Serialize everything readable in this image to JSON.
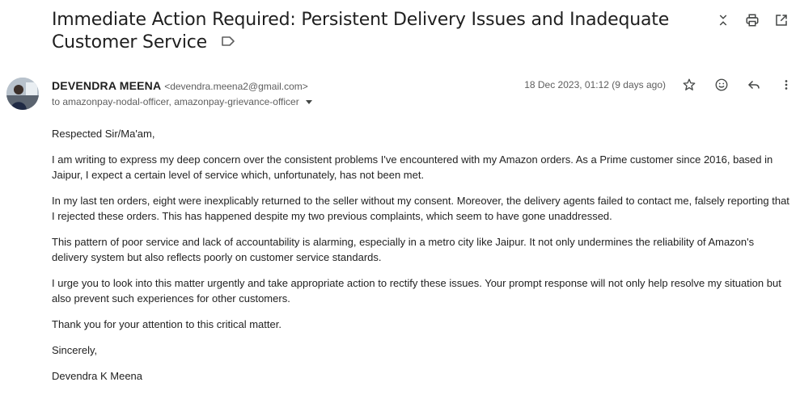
{
  "email": {
    "subject": "Immediate Action Required: Persistent Delivery Issues and Inadequate Customer Service",
    "sender_name": "DEVENDRA MEENA",
    "sender_email": "<devendra.meena2@gmail.com>",
    "recipients": "to amazonpay-nodal-officer, amazonpay-grievance-officer",
    "date": "18 Dec 2023, 01:12 (9 days ago)",
    "body": [
      "Respected Sir/Ma'am,",
      "I am writing to express my deep concern over the consistent problems I've encountered with my Amazon orders. As a Prime customer since 2016, based in Jaipur, I expect a certain level of service which, unfortunately, has not been met.",
      "In my last ten orders, eight were inexplicably returned to the seller without my consent. Moreover, the delivery agents failed to contact me, falsely reporting that I rejected these orders. This has happened despite my two previous complaints, which seem to have gone unaddressed.",
      "This pattern of poor service and lack of accountability is alarming, especially in a metro city like Jaipur. It not only undermines the reliability of Amazon's delivery system but also reflects poorly on customer service standards.",
      "I urge you to look into this matter urgently and take appropriate action to rectify these issues. Your prompt response will not only help resolve my situation but also prevent such experiences for other customers.",
      "Thank you for your attention to this critical matter.",
      "Sincerely,",
      "Devendra K Meena"
    ]
  },
  "icons": {
    "label": "label-outline-icon",
    "collapse": "unfold-less-icon",
    "print": "print-icon",
    "open_new": "open-in-new-icon",
    "star": "star-outline-icon",
    "emoji": "emoji-reaction-icon",
    "reply": "reply-icon",
    "more": "more-vertical-icon"
  },
  "colors": {
    "text_primary": "#1f1f1f",
    "text_secondary": "#5e5e5e",
    "icon": "#444746"
  }
}
